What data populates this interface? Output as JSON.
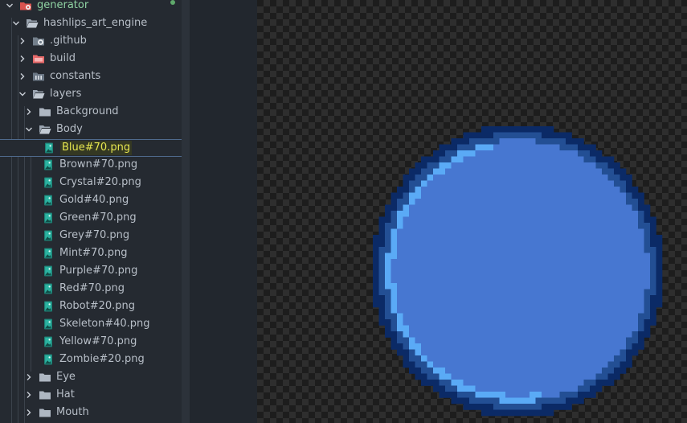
{
  "explorer": {
    "tree": [
      {
        "label": "generator",
        "kind": "root",
        "expanded": true,
        "depth": 0,
        "icon": "generator-folder-icon",
        "dot": true
      },
      {
        "label": "hashlips_art_engine",
        "kind": "folder",
        "expanded": true,
        "depth": 1,
        "icon": "folder-open-icon"
      },
      {
        "label": ".github",
        "kind": "folder",
        "expanded": false,
        "depth": 2,
        "icon": "github-folder-icon"
      },
      {
        "label": "build",
        "kind": "folder",
        "expanded": false,
        "depth": 2,
        "icon": "build-folder-icon"
      },
      {
        "label": "constants",
        "kind": "folder",
        "expanded": false,
        "depth": 2,
        "icon": "constants-folder-icon"
      },
      {
        "label": "layers",
        "kind": "folder",
        "expanded": true,
        "depth": 2,
        "icon": "folder-open-icon"
      },
      {
        "label": "Background",
        "kind": "folder",
        "expanded": false,
        "depth": 3,
        "icon": "folder-icon"
      },
      {
        "label": "Body",
        "kind": "folder",
        "expanded": true,
        "depth": 3,
        "icon": "folder-open-icon"
      },
      {
        "label": "Blue#70.png",
        "kind": "file",
        "depth": 4,
        "icon": "image-file-icon",
        "selected": true
      },
      {
        "label": "Brown#70.png",
        "kind": "file",
        "depth": 4,
        "icon": "image-file-icon"
      },
      {
        "label": "Crystal#20.png",
        "kind": "file",
        "depth": 4,
        "icon": "image-file-icon"
      },
      {
        "label": "Gold#40.png",
        "kind": "file",
        "depth": 4,
        "icon": "image-file-icon"
      },
      {
        "label": "Green#70.png",
        "kind": "file",
        "depth": 4,
        "icon": "image-file-icon"
      },
      {
        "label": "Grey#70.png",
        "kind": "file",
        "depth": 4,
        "icon": "image-file-icon"
      },
      {
        "label": "Mint#70.png",
        "kind": "file",
        "depth": 4,
        "icon": "image-file-icon"
      },
      {
        "label": "Purple#70.png",
        "kind": "file",
        "depth": 4,
        "icon": "image-file-icon"
      },
      {
        "label": "Red#70.png",
        "kind": "file",
        "depth": 4,
        "icon": "image-file-icon"
      },
      {
        "label": "Robot#20.png",
        "kind": "file",
        "depth": 4,
        "icon": "image-file-icon"
      },
      {
        "label": "Skeleton#40.png",
        "kind": "file",
        "depth": 4,
        "icon": "image-file-icon"
      },
      {
        "label": "Yellow#70.png",
        "kind": "file",
        "depth": 4,
        "icon": "image-file-icon"
      },
      {
        "label": "Zombie#20.png",
        "kind": "file",
        "depth": 4,
        "icon": "image-file-icon"
      },
      {
        "label": "Eye",
        "kind": "folder",
        "expanded": false,
        "depth": 3,
        "icon": "folder-icon"
      },
      {
        "label": "Hat",
        "kind": "folder",
        "expanded": false,
        "depth": 3,
        "icon": "folder-icon"
      },
      {
        "label": "Mouth",
        "kind": "folder",
        "expanded": false,
        "depth": 3,
        "icon": "folder-icon"
      }
    ]
  },
  "preview": {
    "image": "Blue#70.png",
    "colors": {
      "outline": "#0b2a66",
      "rim": "#234f94",
      "fill": "#4777d1",
      "highlight": "#5aaaf6",
      "checker_dark": "#1d1d1d",
      "checker_light": "#2e2e2e"
    }
  }
}
